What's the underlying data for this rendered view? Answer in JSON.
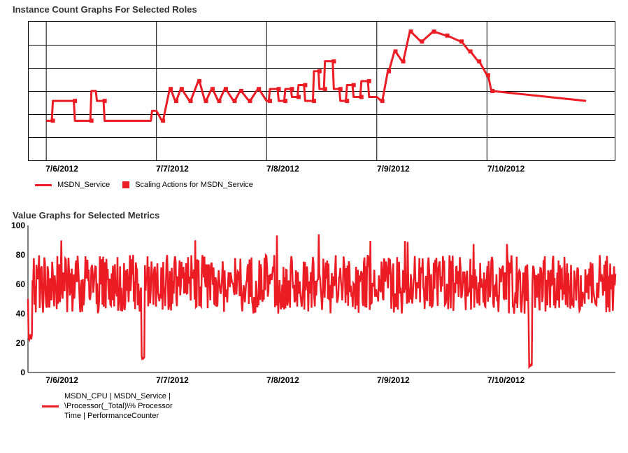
{
  "chart_data": [
    {
      "type": "line",
      "title": "Instance Count Graphs For Selected Roles",
      "xlabel": "",
      "ylabel": "",
      "x_ticks": [
        "7/6/2012",
        "7/7/2012",
        "7/8/2012",
        "7/9/2012",
        "7/10/2012"
      ],
      "ylim": [
        0,
        7
      ],
      "grid": true,
      "legend": [
        {
          "name": "MSDN_Service",
          "marker": "line"
        },
        {
          "name": "Scaling Actions for MSDN_Service",
          "marker": "square"
        }
      ],
      "series": [
        {
          "name": "MSDN_Service",
          "x_day_frac": [
            0.0,
            0.05,
            0.06,
            0.25,
            0.26,
            0.4,
            0.41,
            0.45,
            0.46,
            0.52,
            0.53,
            0.95,
            0.96,
            1.0,
            1.05,
            1.06,
            1.12,
            1.13,
            1.17,
            1.18,
            1.22,
            1.23,
            1.3,
            1.31,
            1.38,
            1.39,
            1.44,
            1.45,
            1.5,
            1.51,
            1.56,
            1.57,
            1.62,
            1.63,
            1.7,
            1.71,
            1.76,
            1.77,
            1.84,
            1.85,
            1.92,
            1.93,
            2.0,
            2.02,
            2.03,
            2.1,
            2.11,
            2.16,
            2.17,
            2.22,
            2.23,
            2.28,
            2.29,
            2.34,
            2.35,
            2.42,
            2.43,
            2.47,
            2.48,
            2.52,
            2.53,
            2.6,
            2.61,
            2.66,
            2.67,
            2.72,
            2.73,
            2.78,
            2.79,
            2.85,
            2.86,
            2.92,
            2.93,
            3.0,
            3.04,
            3.05,
            3.1,
            3.11,
            3.16,
            3.17,
            3.23,
            3.24,
            3.3,
            3.31,
            3.4,
            3.41,
            3.51,
            3.52,
            3.63,
            3.64,
            3.76,
            3.77,
            3.84,
            3.85,
            3.92,
            3.93,
            4.0,
            4.01,
            4.04,
            4.05,
            4.9
          ],
          "values": [
            2,
            2,
            3,
            3,
            2,
            2,
            3.5,
            3.5,
            3,
            3,
            2,
            2,
            2.5,
            2.5,
            2,
            2,
            3.6,
            3.6,
            3,
            3,
            3.6,
            3.6,
            3,
            3,
            4,
            4,
            3,
            3,
            3.6,
            3.6,
            3,
            3,
            3.6,
            3.6,
            3,
            3,
            3.5,
            3.5,
            3,
            3,
            3.6,
            3.6,
            3,
            3,
            3.6,
            3.6,
            3,
            3,
            3.6,
            3.6,
            3.2,
            3.2,
            3.8,
            3.8,
            3,
            3,
            4.5,
            4.5,
            3.6,
            3.6,
            5,
            5,
            3.6,
            3.6,
            3,
            3,
            3.8,
            3.8,
            3.2,
            3.2,
            4,
            4,
            3.2,
            3.2,
            3,
            3,
            4.5,
            4.5,
            5.5,
            5.5,
            5,
            5,
            6.5,
            6.5,
            6,
            6,
            6.5,
            6.5,
            6.3,
            6.3,
            6,
            6,
            5.5,
            5.5,
            5,
            5,
            4.3,
            4.3,
            3.5,
            3.5,
            3,
            3,
            3,
            3
          ]
        }
      ],
      "scaling_action_points_day_frac": [
        0.06,
        0.41,
        0.26,
        0.53,
        1.06,
        1.13,
        1.18,
        1.23,
        1.31,
        1.39,
        1.45,
        1.51,
        1.57,
        1.63,
        1.71,
        1.77,
        1.85,
        1.93,
        2.03,
        2.11,
        2.17,
        2.23,
        2.29,
        2.35,
        2.43,
        2.48,
        2.53,
        2.61,
        2.67,
        2.73,
        2.79,
        2.86,
        2.93,
        3.05,
        3.11,
        3.17,
        3.24,
        3.31,
        3.41,
        3.52,
        3.64,
        3.77,
        3.85,
        3.93,
        4.01,
        4.05
      ]
    },
    {
      "type": "line",
      "title": "Value Graphs for Selected Metrics",
      "xlabel": "",
      "ylabel": "",
      "x_ticks": [
        "7/6/2012",
        "7/7/2012",
        "7/8/2012",
        "7/9/2012",
        "7/10/2012"
      ],
      "y_ticks": [
        0,
        20,
        40,
        60,
        80,
        100
      ],
      "ylim": [
        0,
        100
      ],
      "grid": false,
      "legend": [
        {
          "name": "MSDN_CPU | MSDN_Service | \\Processor(_Total)\\% Processor Time | PerformanceCounter",
          "marker": "line"
        }
      ],
      "series": [
        {
          "name": "MSDN_CPU",
          "baseline_approx": 60,
          "amplitude_approx": 20,
          "notable_dips_day_frac": [
            0.02,
            0.92,
            4.02
          ],
          "notable_dip_values": [
            22,
            8,
            3
          ],
          "spike_high_approx": 95
        }
      ]
    }
  ],
  "chart1_title": "Instance Count Graphs For Selected Roles",
  "chart2_title": "Value Graphs for Selected Metrics",
  "x_ticks": [
    "7/6/2012",
    "7/7/2012",
    "7/8/2012",
    "7/9/2012",
    "7/10/2012"
  ],
  "y_ticks2": [
    "0",
    "20",
    "40",
    "60",
    "80",
    "100"
  ],
  "legend1a": "MSDN_Service",
  "legend1b": "Scaling Actions for MSDN_Service",
  "legend2": "MSDN_CPU | MSDN_Service | \\Processor(_Total)\\% Processor Time | PerformanceCounter"
}
